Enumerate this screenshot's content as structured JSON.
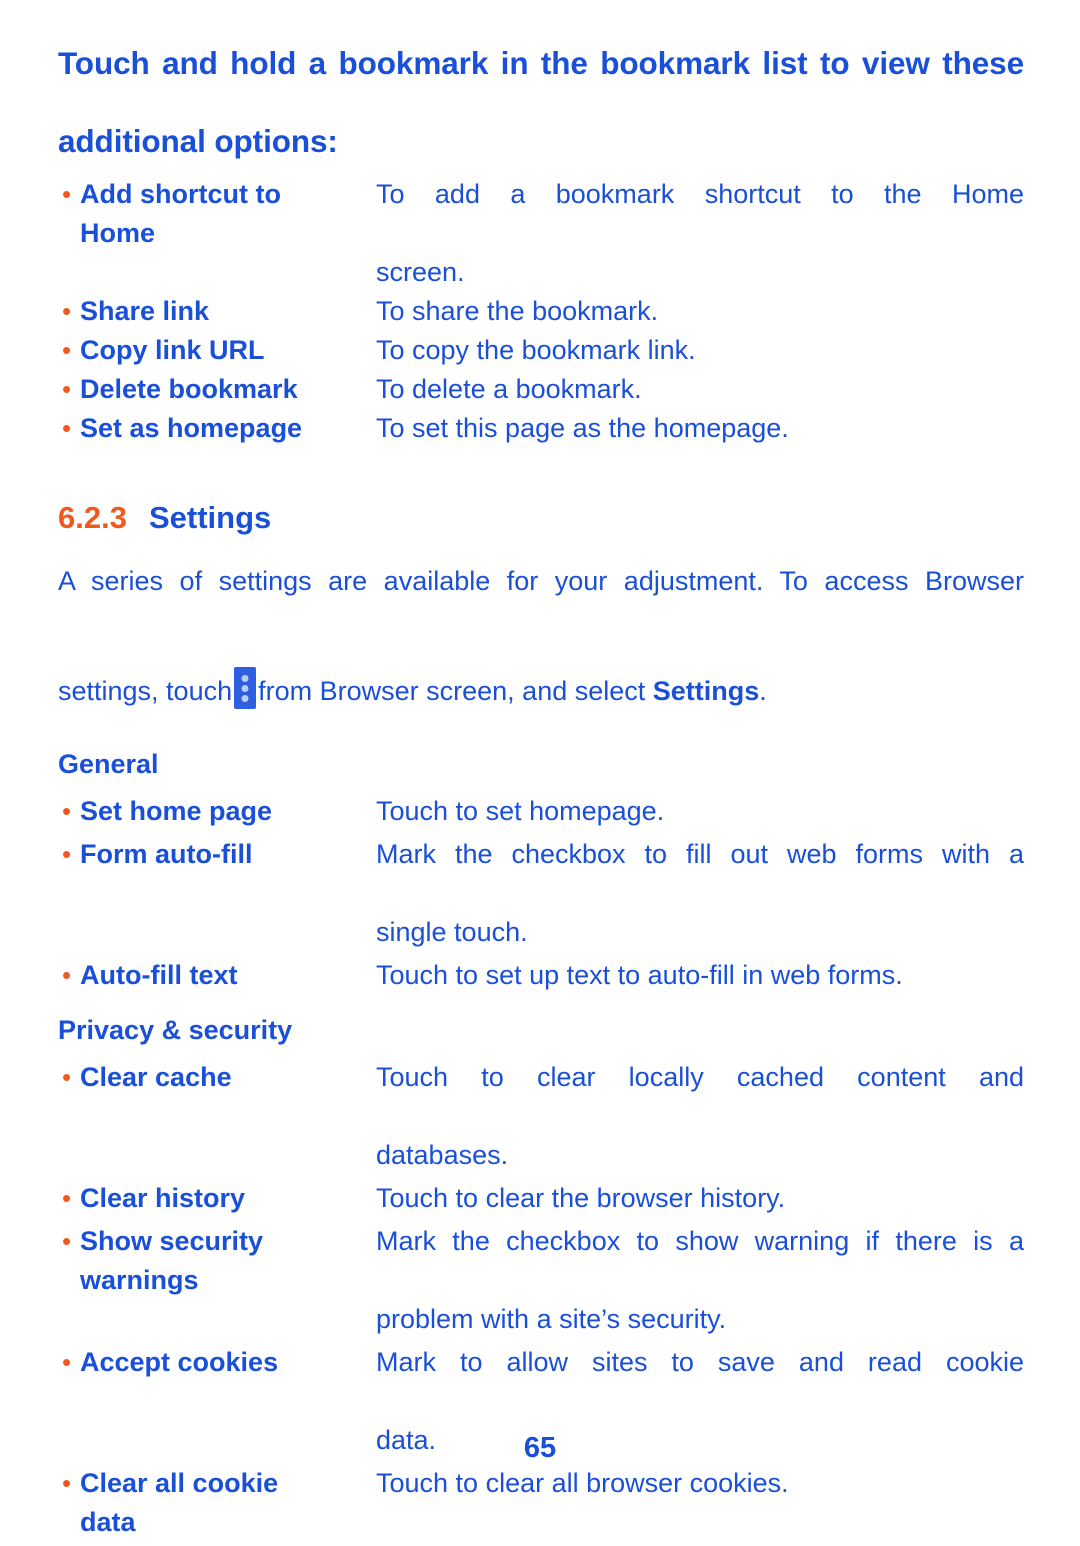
{
  "document": {
    "page_number": "65",
    "colors": {
      "text_blue": "#1a4fd8",
      "accent_orange": "#F1581F",
      "icon_background": "#2d5fe0",
      "icon_dot": "#b9cdf3"
    }
  },
  "intro": {
    "heading_line1": "Touch and hold a bookmark in the bookmark list to view these",
    "heading_line2": "additional options:",
    "options": [
      {
        "term": "Add shortcut to",
        "term_line2": "Home",
        "desc_line1": "To add a bookmark shortcut to the Home",
        "desc_line2": "screen."
      },
      {
        "term": "Share link",
        "desc": "To share the bookmark."
      },
      {
        "term": "Copy link URL",
        "desc": "To copy the bookmark link."
      },
      {
        "term": "Delete bookmark",
        "desc": "To delete a bookmark."
      },
      {
        "term": "Set as homepage",
        "desc": "To set this page as the homepage."
      }
    ]
  },
  "section": {
    "number": "6.2.3",
    "title": "Settings",
    "paragraph": {
      "line1": "A series of settings are available for your adjustment. To access Browser",
      "line2_before_icon": "settings, touch",
      "icon_name": "overflow-menu-icon",
      "line2_after_icon": "from Browser screen, and select",
      "line2_bold": "Settings",
      "line2_end": "."
    }
  },
  "general": {
    "heading": "General",
    "items": [
      {
        "term": "Set home page",
        "desc": "Touch to set homepage."
      },
      {
        "term": "Form auto-fill",
        "desc_line1": "Mark the checkbox to fill out web forms with a",
        "desc_line2": "single touch."
      },
      {
        "term": "Auto-fill text",
        "desc": "Touch to set up text to auto-fill in web forms."
      }
    ]
  },
  "privacy": {
    "heading": "Privacy & security",
    "items": [
      {
        "term": "Clear cache",
        "desc_line1": "Touch to clear locally cached content and",
        "desc_line2": "databases."
      },
      {
        "term": "Clear history",
        "desc": "Touch to clear the browser history."
      },
      {
        "term": "Show security",
        "term_line2": "warnings",
        "desc_line1": "Mark the checkbox to show warning if there is a",
        "desc_line2": "problem with a site’s security."
      },
      {
        "term": "Accept cookies",
        "desc_line1": "Mark to allow sites to save and read cookie",
        "desc_line2": "data."
      },
      {
        "term": "Clear all cookie",
        "term_line2": "data",
        "desc": "Touch to clear all browser cookies."
      }
    ]
  }
}
